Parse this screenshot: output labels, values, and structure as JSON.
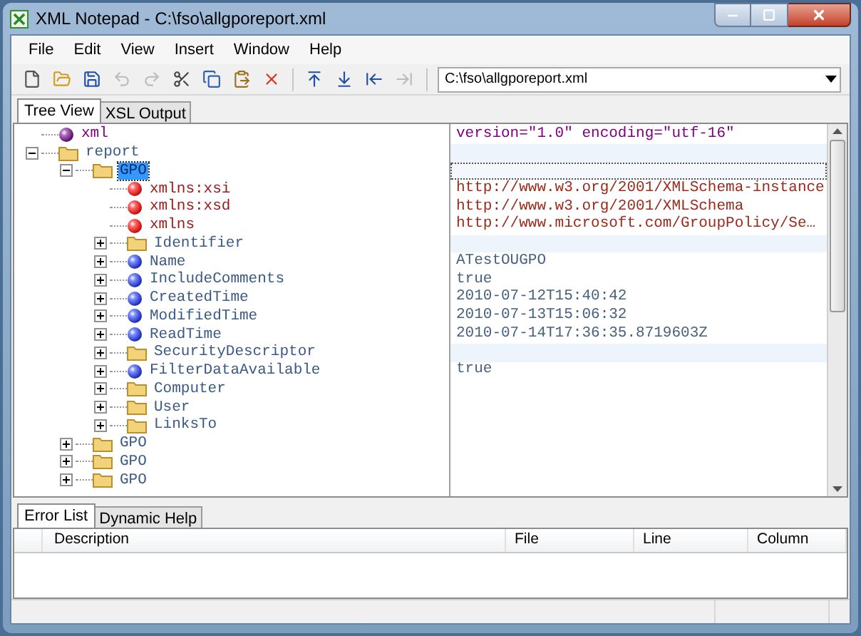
{
  "window": {
    "title": "XML Notepad - C:\\fso\\allgporeport.xml"
  },
  "menu": [
    "File",
    "Edit",
    "View",
    "Insert",
    "Window",
    "Help"
  ],
  "toolbar": [
    {
      "kind": "new",
      "disabled": false
    },
    {
      "kind": "open",
      "disabled": false
    },
    {
      "kind": "save",
      "disabled": false
    },
    {
      "kind": "undo",
      "disabled": true
    },
    {
      "kind": "redo",
      "disabled": true
    },
    {
      "kind": "cut",
      "disabled": false
    },
    {
      "kind": "copy",
      "disabled": false
    },
    {
      "kind": "paste",
      "disabled": false
    },
    {
      "kind": "delete",
      "disabled": false
    },
    {
      "kind": "nudge-up",
      "disabled": false
    },
    {
      "kind": "nudge-down",
      "disabled": false
    },
    {
      "kind": "nudge-left",
      "disabled": false
    },
    {
      "kind": "nudge-right",
      "disabled": true
    }
  ],
  "location": {
    "value": "C:\\fso\\allgporeport.xml"
  },
  "tabs": [
    {
      "label": "Tree View",
      "selected": true
    },
    {
      "label": "XSL Output",
      "selected": false
    }
  ],
  "tree": [
    {
      "name": "xml",
      "kind": "pi",
      "value": "version=\"1.0\" encoding=\"utf-16\"",
      "selected": false
    },
    {
      "name": "report",
      "kind": "element",
      "expanded": true,
      "selected": false,
      "children": [
        {
          "name": "GPO",
          "kind": "element",
          "expanded": true,
          "selected": true,
          "children": [
            {
              "name": "xmlns:xsi",
              "kind": "attribute",
              "value": "http://www.w3.org/2001/XMLSchema-instance",
              "selected": false
            },
            {
              "name": "xmlns:xsd",
              "kind": "attribute",
              "value": "http://www.w3.org/2001/XMLSchema",
              "selected": false
            },
            {
              "name": "xmlns",
              "kind": "attribute",
              "value": "http://www.microsoft.com/GroupPolicy/Se…",
              "selected": false
            },
            {
              "name": "Identifier",
              "kind": "element",
              "expanded": false,
              "selected": false
            },
            {
              "name": "Name",
              "kind": "text",
              "expanded": false,
              "value": "ATestOUGPO",
              "selected": false
            },
            {
              "name": "IncludeComments",
              "kind": "text",
              "expanded": false,
              "value": "true",
              "selected": false
            },
            {
              "name": "CreatedTime",
              "kind": "text",
              "expanded": false,
              "value": "2010-07-12T15:40:42",
              "selected": false
            },
            {
              "name": "ModifiedTime",
              "kind": "text",
              "expanded": false,
              "value": "2010-07-13T15:06:32",
              "selected": false
            },
            {
              "name": "ReadTime",
              "kind": "text",
              "expanded": false,
              "value": "2010-07-14T17:36:35.8719603Z",
              "selected": false
            },
            {
              "name": "SecurityDescriptor",
              "kind": "element",
              "expanded": false,
              "selected": false
            },
            {
              "name": "FilterDataAvailable",
              "kind": "text",
              "expanded": false,
              "value": "true",
              "selected": false
            },
            {
              "name": "Computer",
              "kind": "element",
              "expanded": false,
              "selected": false
            },
            {
              "name": "User",
              "kind": "element",
              "expanded": false,
              "selected": false
            },
            {
              "name": "LinksTo",
              "kind": "element",
              "expanded": false,
              "selected": false
            }
          ]
        },
        {
          "name": "GPO",
          "kind": "element",
          "expanded": false,
          "selected": false
        },
        {
          "name": "GPO",
          "kind": "element",
          "expanded": false,
          "selected": false
        },
        {
          "name": "GPO",
          "kind": "element",
          "expanded": false,
          "selected": false
        }
      ]
    }
  ],
  "bottom_tabs": [
    {
      "label": "Error List",
      "selected": true
    },
    {
      "label": "Dynamic Help",
      "selected": false
    }
  ],
  "error_list": {
    "columns": [
      "Description",
      "File",
      "Line",
      "Column"
    ]
  }
}
